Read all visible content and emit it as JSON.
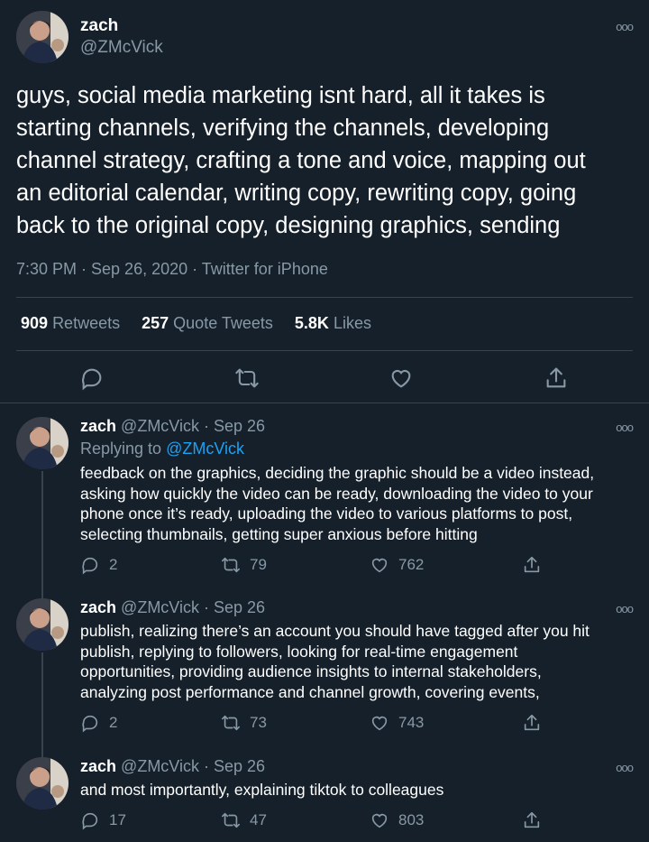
{
  "main_tweet": {
    "name": "zach",
    "handle": "@ZMcVick",
    "text_lines": [
      "guys, social media marketing isnt hard, all it takes is",
      "starting channels, verifying the channels, developing",
      "channel strategy, crafting a tone and voice, mapping out",
      "an editorial calendar, writing copy, rewriting copy, going",
      "back to the original copy, designing graphics, sending"
    ],
    "meta": "7:30 PM · Sep 26, 2020 · Twitter for iPhone",
    "retweets_count": "909",
    "retweets_label": "Retweets",
    "quotes_count": "257",
    "quotes_label": "Quote Tweets",
    "likes_count": "5.8K",
    "likes_label": "Likes"
  },
  "replies": [
    {
      "name": "zach",
      "handle_date": "@ZMcVick · Sep 26",
      "replying_prefix": "Replying to",
      "replying_handle": "@ZMcVick",
      "text_lines": [
        "feedback on the graphics, deciding the graphic should be a video instead,",
        "asking how quickly the video can be ready, downloading the video to your",
        "phone once it’s ready, uploading the video to various platforms to post,",
        "selecting thumbnails, getting super anxious before hitting"
      ],
      "replies": "2",
      "retweets": "79",
      "likes": "762"
    },
    {
      "name": "zach",
      "handle_date": "@ZMcVick · Sep 26",
      "text_lines": [
        "publish, realizing there’s an account you should have tagged after you hit",
        "publish, replying to followers, looking for real-time engagement",
        "opportunities, providing audience insights to internal stakeholders,",
        "analyzing post performance and channel growth, covering events,"
      ],
      "replies": "2",
      "retweets": "73",
      "likes": "743"
    },
    {
      "name": "zach",
      "handle_date": "@ZMcVick · Sep 26",
      "text_lines": [
        "and most importantly, explaining tiktok to colleagues"
      ],
      "replies": "17",
      "retweets": "47",
      "likes": "803"
    }
  ],
  "more_icon_glyph": "ooo",
  "colors": {
    "background": "#15202b",
    "secondary_text": "#8899a6",
    "link": "#1da1f2",
    "divider": "#38444d"
  }
}
